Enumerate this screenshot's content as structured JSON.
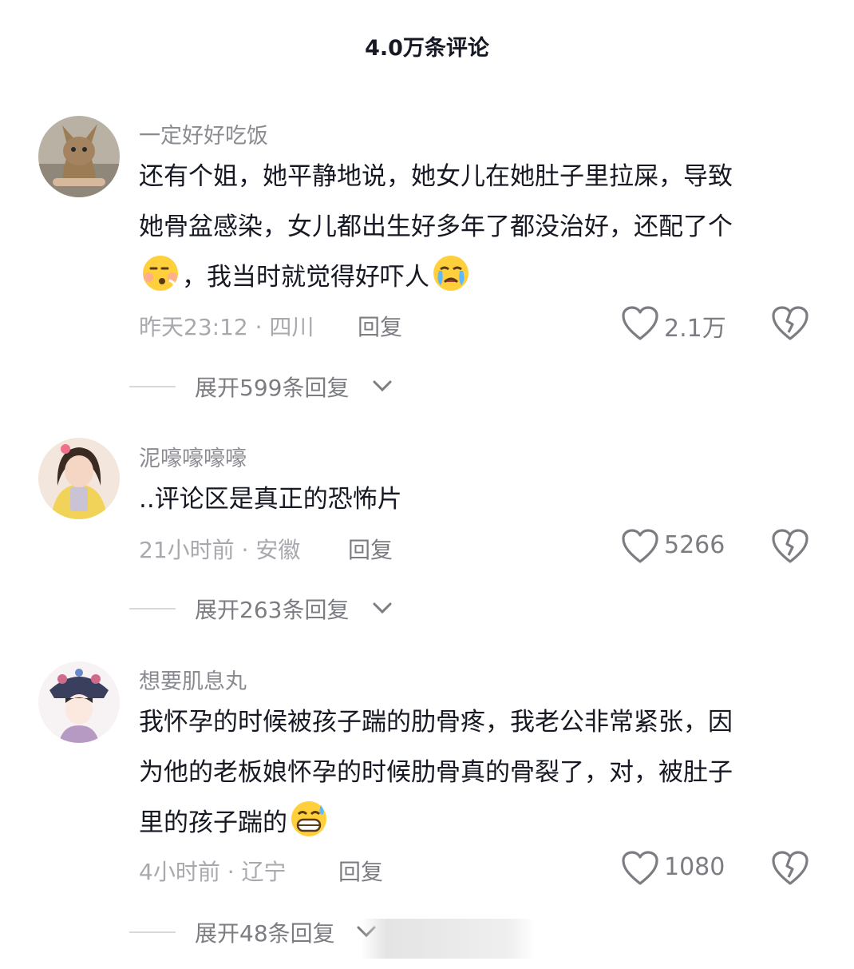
{
  "header": {
    "title": "4.0万条评论"
  },
  "comments": [
    {
      "username": "一定好好吃饭",
      "lines": [
        "还有个姐，她平静地说，她女儿在她肚子里拉屎，导致",
        "她骨盆感染，女儿都出生好多年了都没治好，还配了个"
      ],
      "line3_after_emoji": "，我当时就觉得好吓人",
      "time": "昨天23:12 · 四川",
      "reply_label": "回复",
      "likes": "2.1万",
      "expand_label": "展开599条回复",
      "emojis": [
        "dizzy-face-emoji",
        "crying-face-emoji"
      ]
    },
    {
      "username": "泥嚎嚎嚎嚎",
      "text": "..评论区是真正的恐怖片",
      "time": "21小时前 · 安徽",
      "reply_label": "回复",
      "likes": "5266",
      "expand_label": "展开263条回复"
    },
    {
      "username": "想要肌息丸",
      "lines": [
        "我怀孕的时候被孩子踹的肋骨疼，我老公非常紧张，因",
        "为他的老板娘怀孕的时候肋骨真的骨裂了，对，被肚子"
      ],
      "line3_before_emoji": "里的孩子踹的",
      "time": "4小时前 · 辽宁",
      "reply_label": "回复",
      "likes": "1080",
      "expand_label": "展开48条回复",
      "emojis": [
        "grinning-sweat-emoji"
      ]
    }
  ]
}
